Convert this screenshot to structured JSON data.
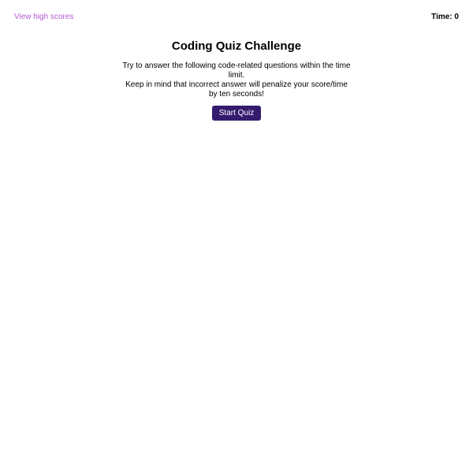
{
  "header": {
    "highscores_link": "View high scores",
    "timer_label": "Time: 0"
  },
  "main": {
    "title": "Coding Quiz Challenge",
    "intro_lines": [
      "Try to answer the following code-related questions within the time limit.",
      "Keep in mind that incorrect answer will penalize your score/time",
      "by ten seconds!"
    ],
    "start_button_label": "Start Quiz"
  },
  "colors": {
    "link": "#b35ad6",
    "button_bg": "#351b6e",
    "button_text": "#ffffff"
  }
}
